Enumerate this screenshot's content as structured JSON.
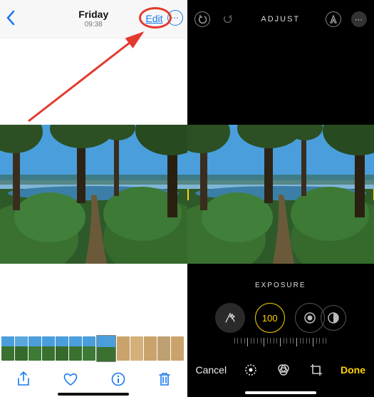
{
  "left": {
    "header": {
      "day": "Friday",
      "time": "09:38",
      "edit": "Edit",
      "more": "⋯"
    },
    "toolbar": {
      "share": "share-icon",
      "favorite": "heart-icon",
      "info": "info-icon",
      "delete": "trash-icon"
    }
  },
  "right": {
    "header": {
      "title": "ADJUST"
    },
    "control_label": "EXPOSURE",
    "exposure_value": "100",
    "footer": {
      "cancel": "Cancel",
      "done": "Done"
    }
  },
  "annotation": {
    "purpose": "Red circle and arrow highlighting the Edit button"
  }
}
